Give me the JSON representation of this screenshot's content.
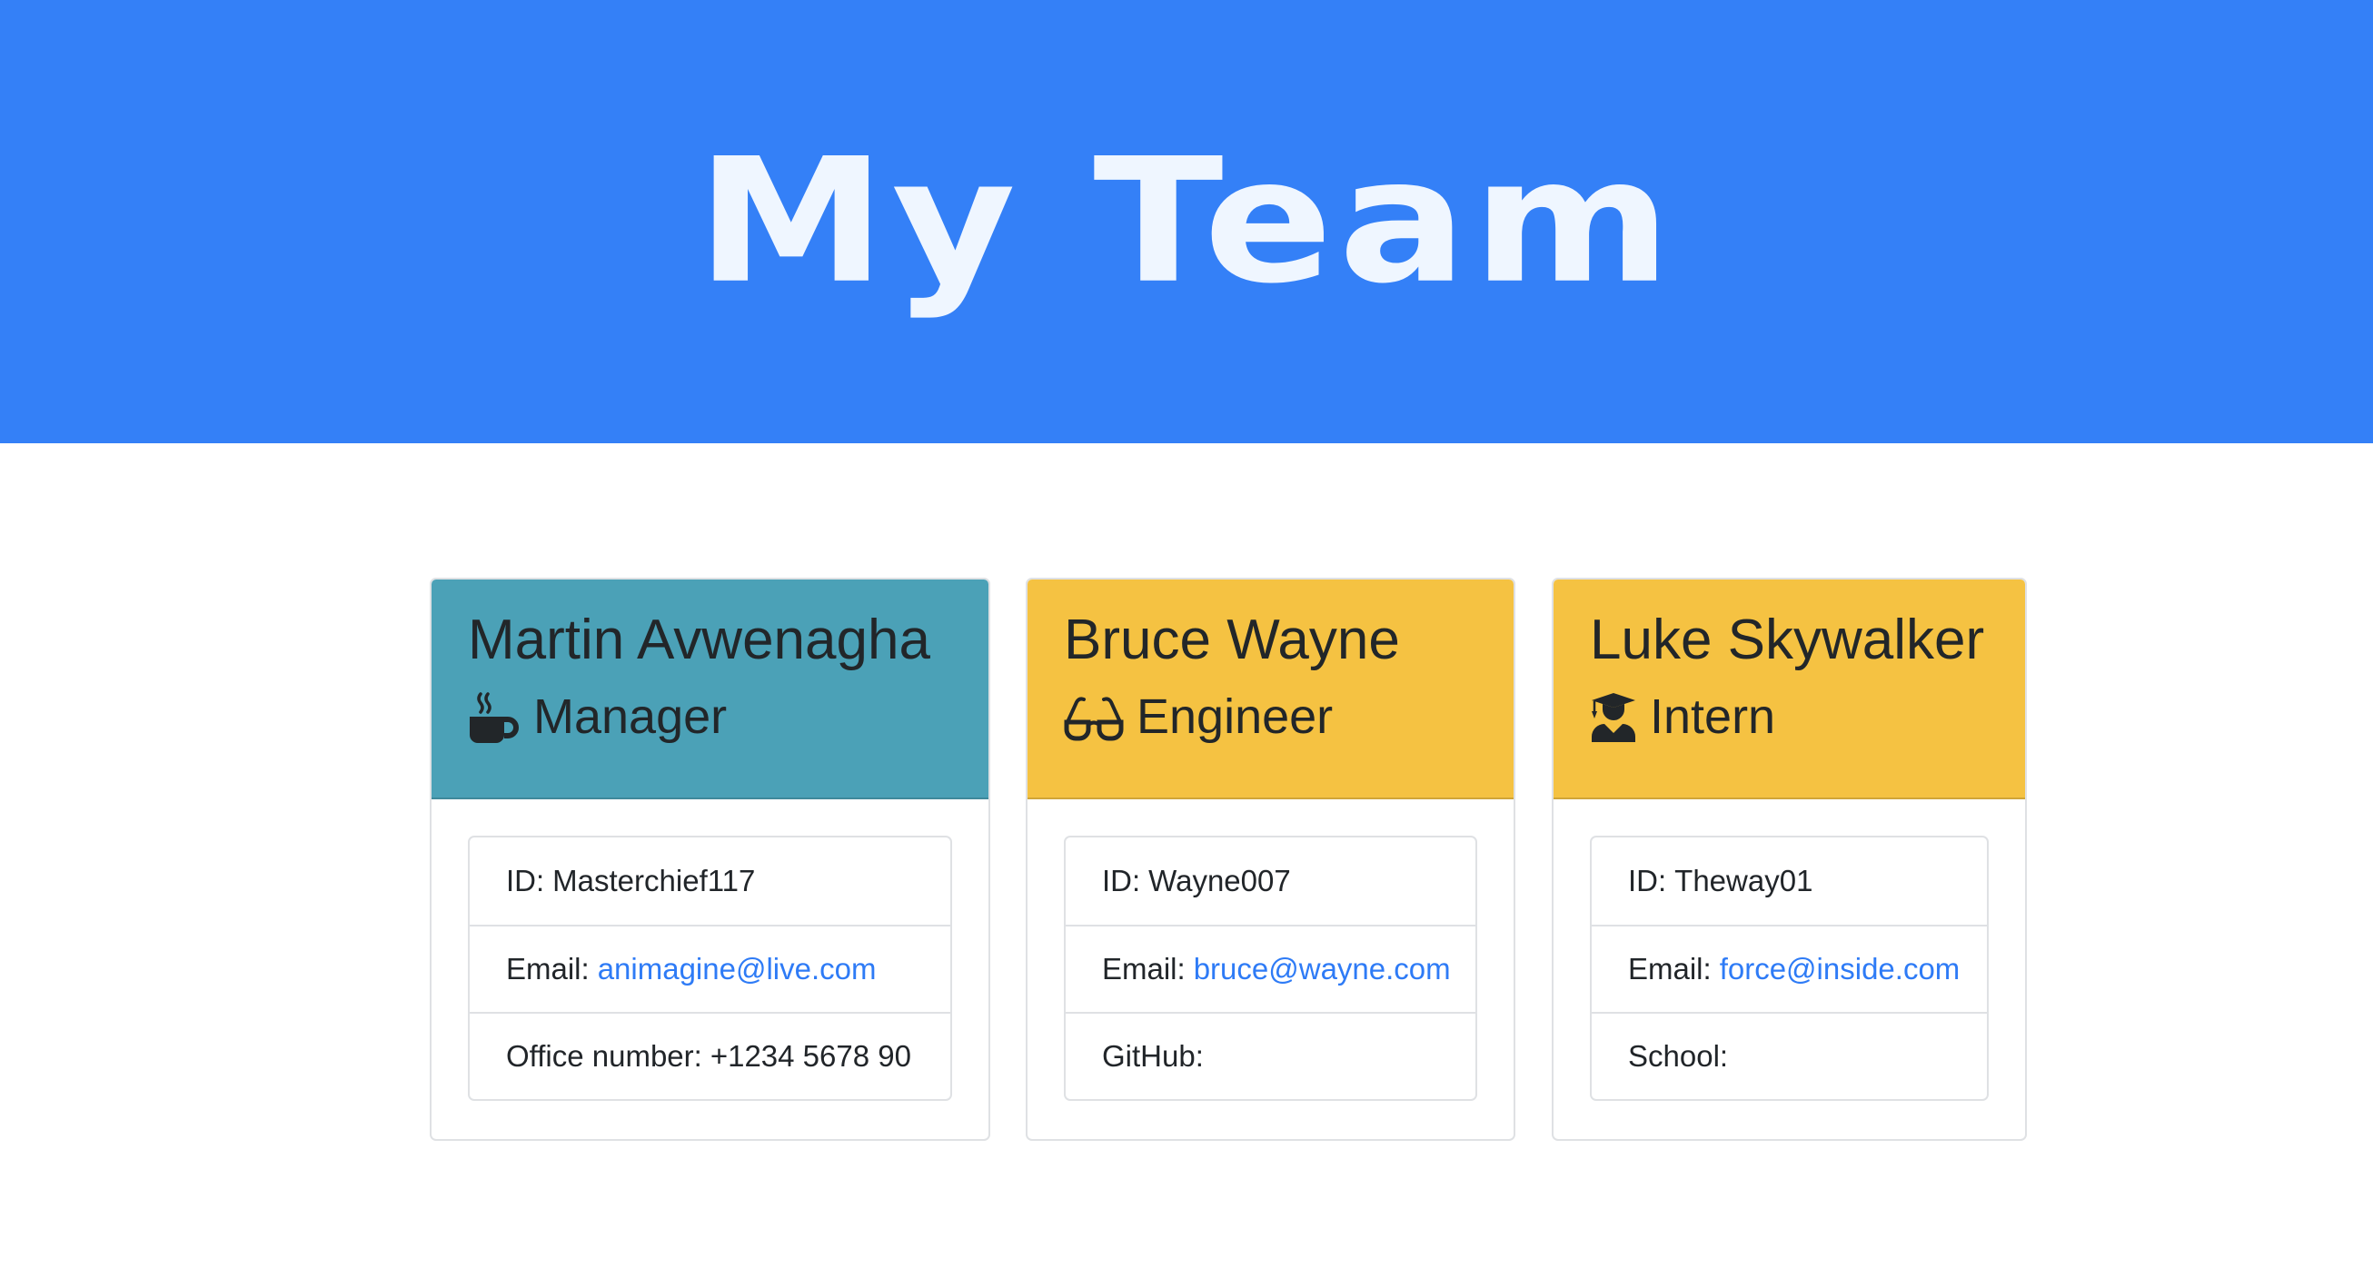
{
  "header": {
    "title": "My Team"
  },
  "colors": {
    "banner": "#3480f7",
    "manager_header": "#4ba1b7",
    "engineer_header": "#f5c242",
    "intern_header": "#f5c242",
    "link": "#2e7bf6"
  },
  "cards": [
    {
      "name": "Martin Avwenagha",
      "role": "Manager",
      "role_icon": "coffee-mug-icon",
      "id_label": "ID:",
      "id_value": "Masterchief117",
      "email_label": "Email:",
      "email": "animagine@live.com",
      "extra_label": "Office number:",
      "extra_value": "+1234 5678 90"
    },
    {
      "name": "Bruce Wayne",
      "role": "Engineer",
      "role_icon": "glasses-icon",
      "id_label": "ID:",
      "id_value": "Wayne007",
      "email_label": "Email:",
      "email": "bruce@wayne.com",
      "extra_label": "GitHub:",
      "extra_value": ""
    },
    {
      "name": "Luke Skywalker",
      "role": "Intern",
      "role_icon": "graduate-icon",
      "id_label": "ID:",
      "id_value": "Theway01",
      "email_label": "Email:",
      "email": "force@inside.com",
      "extra_label": "School:",
      "extra_value": ""
    }
  ]
}
